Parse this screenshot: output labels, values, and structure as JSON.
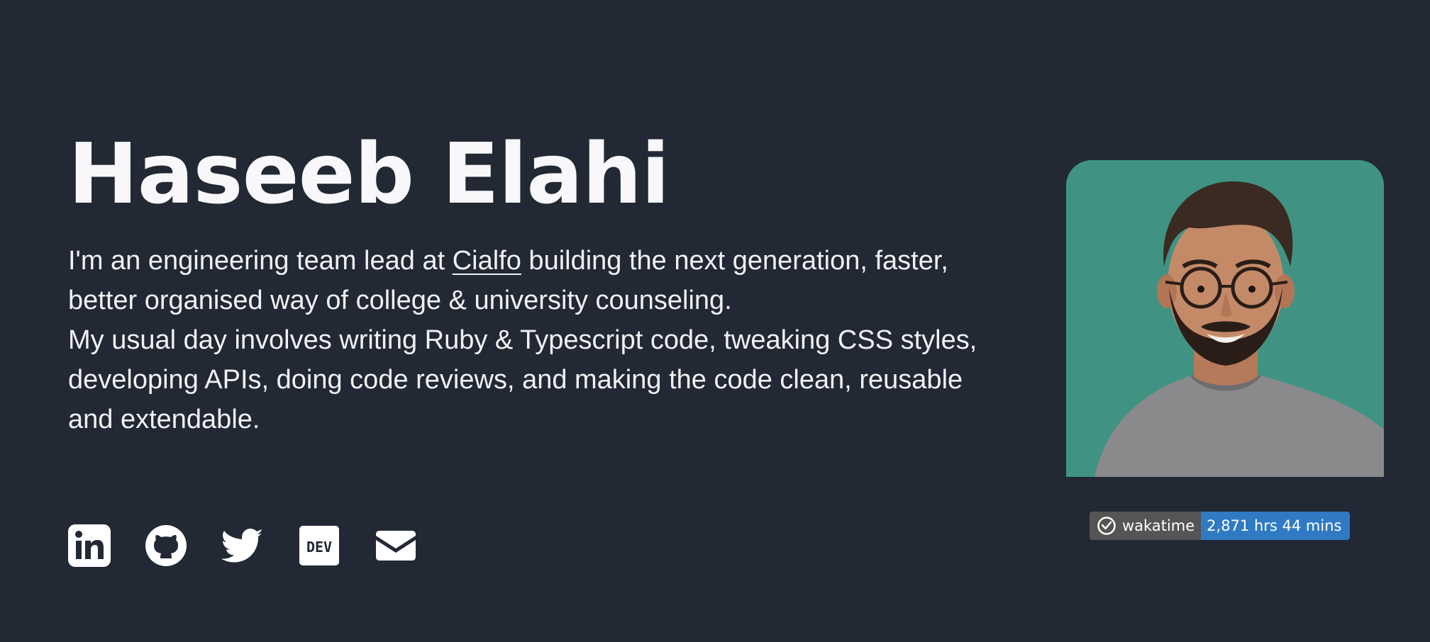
{
  "hero": {
    "name": "Haseeb Elahi",
    "bio": {
      "intro_before": "I'm an engineering team lead at ",
      "company": "Cialfo",
      "intro_after": " building the next generation, faster, better organised way of college & university counseling.",
      "day": "My usual day involves writing Ruby & Typescript code, tweaking CSS styles, developing APIs, doing code reviews, and making the code clean, reusable and extendable."
    }
  },
  "socials": [
    {
      "icon": "linkedin-icon"
    },
    {
      "icon": "github-icon"
    },
    {
      "icon": "twitter-icon"
    },
    {
      "icon": "dev-icon",
      "text": "DEV"
    },
    {
      "icon": "mail-icon"
    }
  ],
  "badge": {
    "label": "wakatime",
    "value": "2,871 hrs 44 mins"
  },
  "colors": {
    "background": "#222834",
    "text": "#f5f5f7",
    "photo_background": "#409383",
    "badge_label_bg": "#555555",
    "badge_value_bg": "#2f7ac3"
  }
}
